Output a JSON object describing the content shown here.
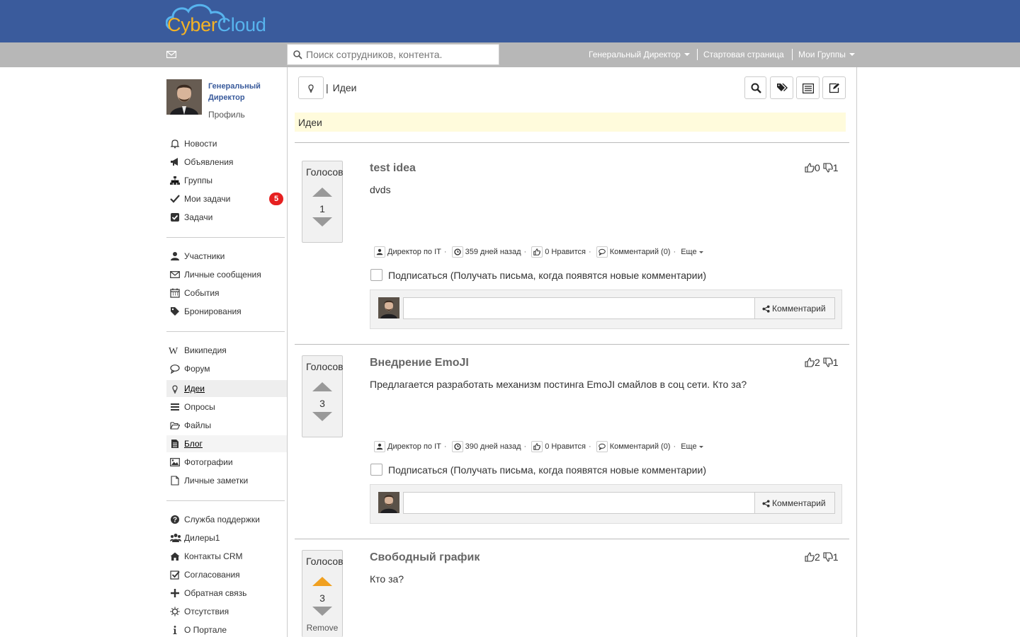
{
  "brand": {
    "logo_text_part1": "Cyber",
    "logo_text_part2": "Cloud",
    "header_color": "#3a5b9c",
    "accent_yellow": "#f5b324",
    "accent_blue": "#57b4ee"
  },
  "topbar": {
    "search_placeholder": "Поиск сотрудников, контента.",
    "nav": {
      "user": "Генеральный Директор",
      "home": "Стартовая страница",
      "groups": "Мои Группы"
    }
  },
  "profile": {
    "name": "Генеральный Директор",
    "profile_link": "Профиль"
  },
  "sidebar": {
    "section1": [
      {
        "label": "Новости",
        "icon": "bell-icon"
      },
      {
        "label": "Объявления",
        "icon": "megaphone-icon"
      },
      {
        "label": "Группы",
        "icon": "sitemap-icon"
      },
      {
        "label": "Мои задачи",
        "icon": "check-icon",
        "badge": "5"
      },
      {
        "label": "Задачи",
        "icon": "checkbox-icon"
      }
    ],
    "section2": [
      {
        "label": "Участники",
        "icon": "user-icon"
      },
      {
        "label": "Личные сообщения",
        "icon": "envelope-icon"
      },
      {
        "label": "События",
        "icon": "calendar-icon"
      },
      {
        "label": "Бронирования",
        "icon": "tag-icon"
      }
    ],
    "section3": [
      {
        "label": "Википедия",
        "icon": "wikipedia-icon"
      },
      {
        "label": "Форум",
        "icon": "comment-icon"
      },
      {
        "label": "Идеи",
        "icon": "lightbulb-icon"
      },
      {
        "label": "Опросы",
        "icon": "list-icon"
      },
      {
        "label": "Файлы",
        "icon": "folder-open-icon"
      },
      {
        "label": "Блог",
        "icon": "file-text-icon"
      },
      {
        "label": "Фотографии",
        "icon": "picture-icon"
      },
      {
        "label": "Личные заметки",
        "icon": "file-icon"
      }
    ],
    "section4": [
      {
        "label": "Служба поддержки",
        "icon": "question-circle-icon"
      },
      {
        "label": "Дилеры1",
        "icon": "users-icon"
      },
      {
        "label": "Контакты CRM",
        "icon": "home-icon"
      },
      {
        "label": "Согласования",
        "icon": "check-square-icon"
      },
      {
        "label": "Обратная связь",
        "icon": "plus-icon"
      },
      {
        "label": "Отсутствия",
        "icon": "sun-icon"
      },
      {
        "label": "О Портале",
        "icon": "info-icon"
      }
    ],
    "badge_color": "#e62020"
  },
  "main": {
    "title": "Идеи",
    "banner": "Идеи",
    "banner_color": "#fffbdc"
  },
  "ideas": [
    {
      "title": "test idea",
      "body": "dvds",
      "votes_label": "Голосов",
      "votes": "1",
      "likes": "0",
      "dislikes": "1",
      "author": "Директор по IT",
      "time": "359 дней назад",
      "likes_text": "0 Нравится",
      "comments": "Комментарий (0)",
      "more": "Еще",
      "subscribe": "Подписаться (Получать письма, когда появятся новые комментарии)",
      "comment_button": "Комментарий"
    },
    {
      "title": "Внедрение EmoJI",
      "body": "Предлагается разработать механизм постинга EmoJI смайлов в соц сети. Кто за?",
      "votes_label": "Голосов",
      "votes": "3",
      "likes": "2",
      "dislikes": "1",
      "author": "Директор по IT",
      "time": "390 дней назад",
      "likes_text": "0 Нравится",
      "comments": "Комментарий (0)",
      "more": "Еще",
      "subscribe": "Подписаться (Получать письма, когда появятся новые комментарии)",
      "comment_button": "Комментарий"
    },
    {
      "title": "Свободный график",
      "body": "Кто за?",
      "votes_label": "Голосов",
      "votes": "3",
      "likes": "2",
      "dislikes": "1",
      "remove": "Remove",
      "voted_up": true,
      "voted_color": "#f0a020"
    }
  ]
}
